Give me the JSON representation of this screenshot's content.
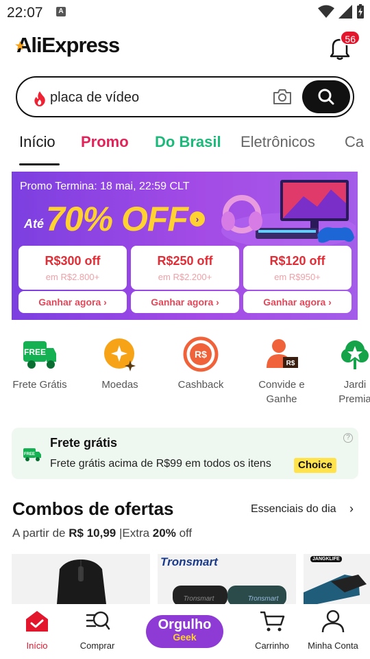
{
  "status_bar": {
    "time": "22:07",
    "notification_icon_letter": "A"
  },
  "header": {
    "logo_text": "AliExpress",
    "notifications_count": "56"
  },
  "search": {
    "query": "placa de vídeo"
  },
  "tabs": [
    {
      "label": "Início",
      "color": "#191919",
      "active": true
    },
    {
      "label": "Promo",
      "color": "#e0245a"
    },
    {
      "label": "Do Brasil",
      "color": "#1db97a"
    },
    {
      "label": "Eletrônicos",
      "color": "#666666"
    },
    {
      "label": "Ca",
      "color": "#666666"
    }
  ],
  "promo": {
    "ends_text": "Promo Termina: 18 mai, 22:59 CLT",
    "upto": "Até",
    "discount": "70% OFF",
    "coupons": [
      {
        "amount": "R$300 off",
        "min": "em R$2.800+",
        "cta": "Ganhar agora ›"
      },
      {
        "amount": "R$250 off",
        "min": "em R$2.200+",
        "cta": "Ganhar agora ›"
      },
      {
        "amount": "R$120 off",
        "min": "em R$950+",
        "cta": "Ganhar agora ›"
      }
    ]
  },
  "quick_links": [
    {
      "label": "Frete Grátis",
      "icon": "free-truck-icon",
      "icon_text": "FREE"
    },
    {
      "label": "Moedas",
      "icon": "coin-icon"
    },
    {
      "label": "Cashback",
      "icon": "cashback-icon",
      "icon_text": "R$"
    },
    {
      "label": "Convide e Ganhe",
      "icon": "invite-icon",
      "icon_text": "R$"
    },
    {
      "label": "Jardi Premia",
      "icon": "garden-icon"
    }
  ],
  "shipping": {
    "title": "Frete grátis",
    "description": "Frete grátis acima de R$99 em todos os itens",
    "badge": "Choice",
    "icon_text": "FREE"
  },
  "combos": {
    "title": "Combos de ofertas",
    "link": "Essenciais do dia",
    "subtitle_prefix": "A partir de",
    "subtitle_price": "R$ 10,99",
    "subtitle_extra": "|Extra",
    "subtitle_percent": "20%",
    "subtitle_suffix": "off",
    "brands": [
      "Tronsmart",
      "JANGKLIFE"
    ]
  },
  "bottom_nav": {
    "home": "Início",
    "shop": "Comprar",
    "promo_main": "Orgulho",
    "promo_sub": "Geek",
    "cart": "Carrinho",
    "account": "Minha Conta"
  }
}
